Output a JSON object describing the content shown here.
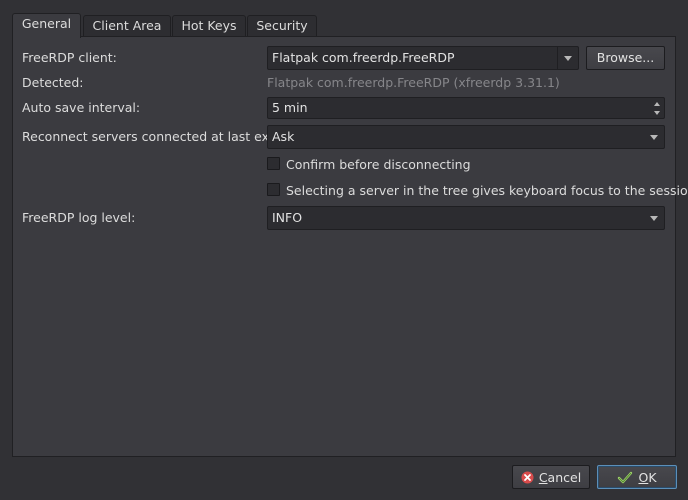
{
  "tabs": [
    {
      "label": "General",
      "active": true
    },
    {
      "label": "Client Area",
      "active": false
    },
    {
      "label": "Hot Keys",
      "active": false
    },
    {
      "label": "Security",
      "active": false
    }
  ],
  "general": {
    "client_label": "FreeRDP client:",
    "client_value": "Flatpak com.freerdp.FreeRDP",
    "browse_label": "Browse...",
    "detected_label": "Detected:",
    "detected_value": "Flatpak com.freerdp.FreeRDP (xfreerdp 3.31.1)",
    "autosave_label": "Auto save interval:",
    "autosave_value": "5 min",
    "reconnect_label": "Reconnect servers connected at last exit:",
    "reconnect_value": "Ask",
    "confirm_label": "Confirm before disconnecting",
    "confirm_checked": false,
    "focus_label": "Selecting a server in the tree gives keyboard focus to the session",
    "focus_checked": false,
    "loglevel_label": "FreeRDP log level:",
    "loglevel_value": "INFO"
  },
  "dialog": {
    "cancel_label": "Cancel",
    "cancel_mnemonic": "C",
    "ok_label": "OK",
    "ok_mnemonic": "O"
  },
  "colors": {
    "background": "#313135",
    "panel": "#3b3b40",
    "field": "#2c2c30",
    "ok_focus_border": "#5c8fb9",
    "cancel_icon": "#d84b4b"
  }
}
